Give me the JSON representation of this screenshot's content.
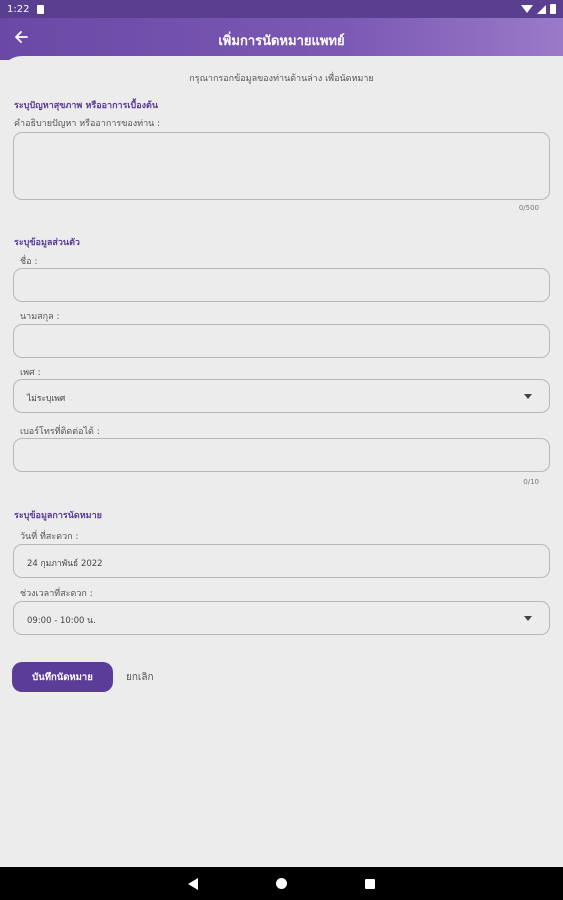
{
  "status_bar": {
    "time": "1:22"
  },
  "app_bar": {
    "title": "เพิ่มการนัดหมายแพทย์"
  },
  "form": {
    "instruction": "กรุณากรอกข้อมูลของท่านด้านล่าง เพื่อนัดหมาย",
    "health_section": {
      "title": "ระบุปัญหาสุขภาพ หรืออาการเบื้องต้น",
      "description_label": "คำอธิบายปัญหา หรืออาการของท่าน :",
      "description_value": "",
      "description_counter": "0/500"
    },
    "personal_section": {
      "title": "ระบุข้อมูลส่วนตัว",
      "first_name_label": "ชื่อ :",
      "first_name_value": "",
      "last_name_label": "นามสกุล :",
      "last_name_value": "",
      "gender_label": "เพศ :",
      "gender_value": "ไม่ระบุเพศ",
      "phone_label": "เบอร์โทรที่ติดต่อได้ :",
      "phone_value": "",
      "phone_counter": "0/10"
    },
    "appointment_section": {
      "title": "ระบุข้อมูลการนัดหมาย",
      "date_label": "วันที่ ที่สะดวก :",
      "date_value": "24 กุมภาพันธ์ 2022",
      "time_label": "ช่วงเวลาที่สะดวก :",
      "time_value": "09:00 - 10:00 น."
    },
    "save_label": "บันทึกนัดหมาย",
    "cancel_label": "ยกเลิก"
  },
  "icons": {
    "back": "arrow-left-icon",
    "dropdown": "caret-down-icon",
    "nav_back": "triangle-back-icon",
    "nav_home": "circle-home-icon",
    "nav_recent": "square-recent-icon"
  },
  "colors": {
    "primary": "#5b3c98",
    "app_bar_start": "#6a49a6",
    "app_bar_end": "#9a7ac8",
    "background": "#ececec"
  }
}
